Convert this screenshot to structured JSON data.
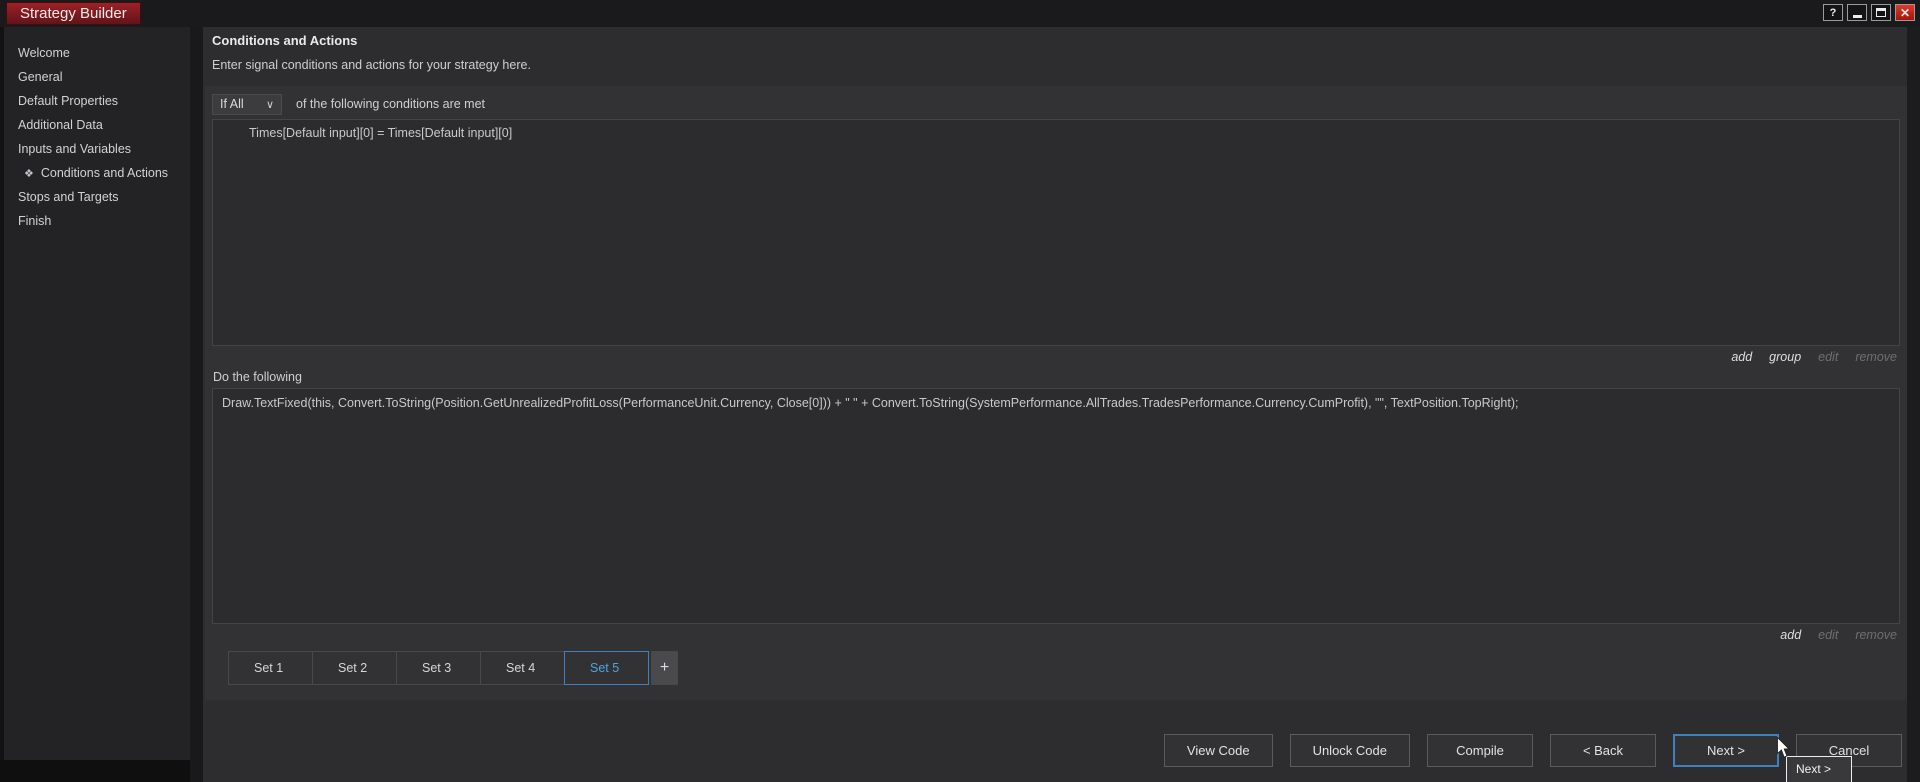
{
  "window": {
    "title": "Strategy Builder",
    "controls": {
      "help": "?",
      "close": "✕"
    }
  },
  "sidebar": {
    "items": [
      {
        "label": "Welcome",
        "active": false
      },
      {
        "label": "General",
        "active": false
      },
      {
        "label": "Default Properties",
        "active": false
      },
      {
        "label": "Additional Data",
        "active": false
      },
      {
        "label": "Inputs and Variables",
        "active": false
      },
      {
        "label": "Conditions and Actions",
        "active": true,
        "icon": "❖"
      },
      {
        "label": "Stops and Targets",
        "active": false
      },
      {
        "label": "Finish",
        "active": false
      }
    ]
  },
  "main": {
    "title": "Conditions and Actions",
    "subtitle": "Enter signal conditions and actions for your strategy here.",
    "conditions": {
      "selector_value": "If All",
      "selector_chevron": "∨",
      "suffix_label": "of the following conditions are met",
      "items": [
        "Times[Default input][0] = Times[Default input][0]"
      ],
      "links": [
        {
          "label": "add",
          "enabled": true
        },
        {
          "label": "group",
          "enabled": true
        },
        {
          "label": "edit",
          "enabled": false
        },
        {
          "label": "remove",
          "enabled": false
        }
      ]
    },
    "actions": {
      "label": "Do the following",
      "items": [
        "Draw.TextFixed(this, Convert.ToString(Position.GetUnrealizedProfitLoss(PerformanceUnit.Currency, Close[0])) + \" \" + Convert.ToString(SystemPerformance.AllTrades.TradesPerformance.Currency.CumProfit), \"\", TextPosition.TopRight);"
      ],
      "links": [
        {
          "label": "add",
          "enabled": true
        },
        {
          "label": "edit",
          "enabled": false
        },
        {
          "label": "remove",
          "enabled": false
        }
      ]
    },
    "tabs": {
      "sets": [
        "Set 1",
        "Set 2",
        "Set 3",
        "Set 4",
        "Set 5"
      ],
      "selected": "Set 5",
      "add_label": "+"
    },
    "footer": {
      "buttons": [
        "View Code",
        "Unlock Code",
        "Compile",
        "< Back",
        "Next >",
        "Cancel"
      ],
      "focused": "Next >"
    },
    "tooltip": "Next >"
  },
  "colors": {
    "accent_blue": "#4fa3e0",
    "title_red": "#8f2025",
    "close_red": "#c8281e",
    "disabled_text": "#6e6f71"
  }
}
